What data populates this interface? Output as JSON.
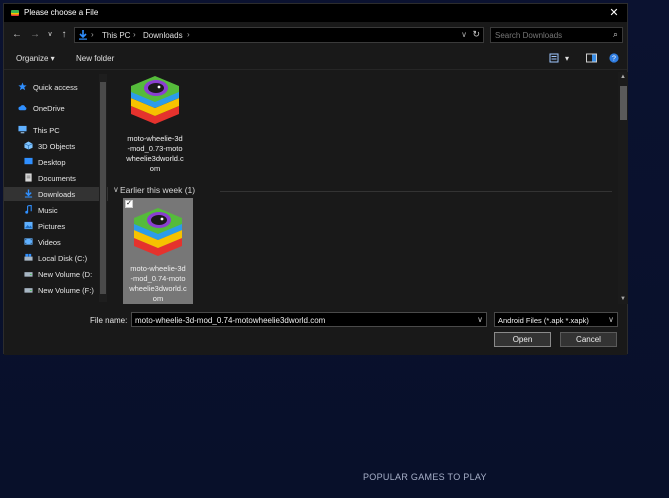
{
  "dialog": {
    "title": "Please choose a File",
    "close_glyph": "✕"
  },
  "nav": {
    "back": "←",
    "forward": "→",
    "recent": "∨",
    "up": "↑",
    "breadcrumb": [
      "This PC",
      "Downloads"
    ],
    "separator": "›",
    "address_dropdown": "∨",
    "refresh": "↻",
    "search_placeholder": "Search Downloads",
    "search_glyph": "⌕"
  },
  "toolbar": {
    "organize": "Organize ▾",
    "new_folder": "New folder",
    "view_dropdown": "▾"
  },
  "sidebar": {
    "items": [
      {
        "label": "Quick access",
        "icon": "star-icon"
      },
      {
        "label": "OneDrive",
        "icon": "cloud-icon"
      },
      {
        "label": "This PC",
        "icon": "pc-icon"
      },
      {
        "label": "3D Objects",
        "icon": "cube-icon"
      },
      {
        "label": "Desktop",
        "icon": "desktop-icon"
      },
      {
        "label": "Documents",
        "icon": "document-icon"
      },
      {
        "label": "Downloads",
        "icon": "download-icon",
        "selected": true
      },
      {
        "label": "Music",
        "icon": "music-icon"
      },
      {
        "label": "Pictures",
        "icon": "picture-icon"
      },
      {
        "label": "Videos",
        "icon": "video-icon"
      },
      {
        "label": "Local Disk (C:)",
        "icon": "disk-icon"
      },
      {
        "label": "New Volume (D:",
        "icon": "disk-icon"
      },
      {
        "label": "New Volume (F:)",
        "icon": "disk-icon"
      }
    ]
  },
  "content": {
    "file1_name_lines": [
      "moto-wheelie-3d",
      "-mod_0.73-moto",
      "wheelie3dworld.c",
      "om"
    ],
    "group_header": "Earlier this week (1)",
    "group_chevron": "∨",
    "file2_name_lines": [
      "moto-wheelie-3d",
      "-mod_0.74-moto",
      "wheelie3dworld.c",
      "om"
    ],
    "check": "✓"
  },
  "bottom": {
    "file_name_label": "File name:",
    "file_name_value": "moto-wheelie-3d-mod_0.74-motowheelie3dworld.com",
    "filter_value": "Android Files (*.apk *.xapk)",
    "dropdown": "∨",
    "open": "Open",
    "cancel": "Cancel"
  },
  "background": {
    "caption": "POPULAR GAMES TO PLAY"
  },
  "colors": {
    "accent": "#1e90ff",
    "dialog_bg": "#191919",
    "titlebar_bg": "#000000"
  }
}
